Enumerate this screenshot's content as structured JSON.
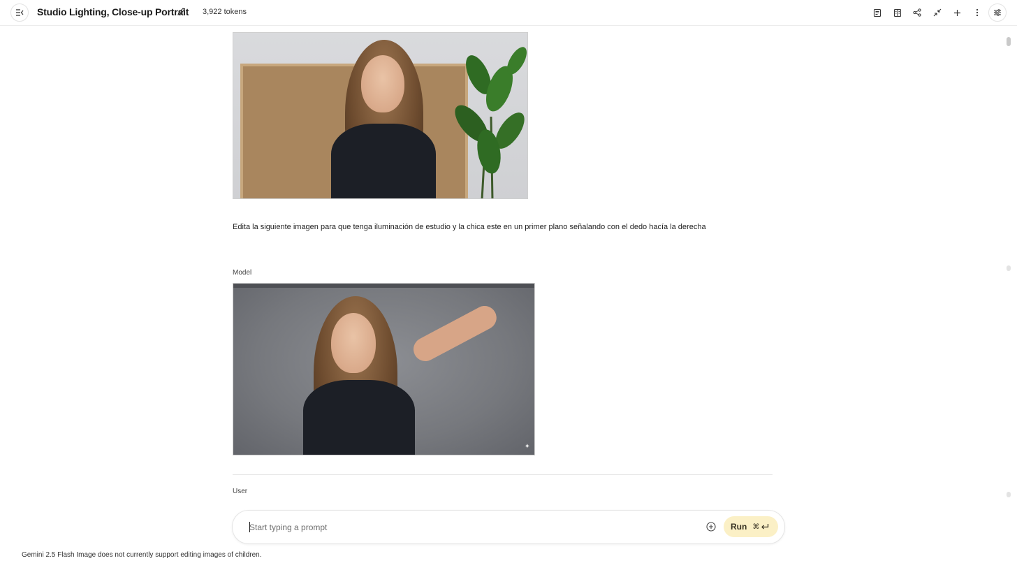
{
  "header": {
    "title": "Studio Lighting, Close-up Portrait",
    "tokens": "3,922 tokens",
    "icons": [
      "menu-collapse-icon",
      "edit-icon",
      "document-icon",
      "compare-icon",
      "share-icon",
      "compress-icon",
      "add-icon",
      "more-vert-icon",
      "tune-icon"
    ]
  },
  "conversation": {
    "user_prompt": "Edita la siguiente imagen para que tenga iluminación de estudio y la chica este en un primer plano señalando con el dedo hacía la derecha",
    "model_label": "Model",
    "next_user_label": "User"
  },
  "composer": {
    "placeholder": "Start typing a prompt",
    "run_label": "Run",
    "shortcut_label": "⌘"
  },
  "footer": {
    "disclaimer": "Gemini 2.5 Flash Image does not currently support editing images of children."
  },
  "colors": {
    "run_button_bg": "#fbf0c6",
    "border": "#e5e5e5"
  }
}
